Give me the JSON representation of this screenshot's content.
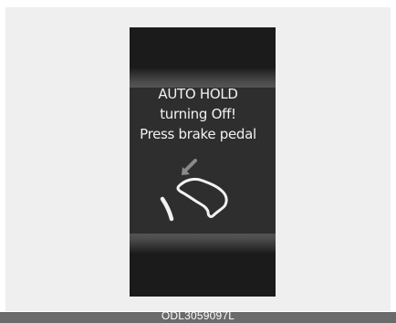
{
  "display": {
    "line1": "AUTO HOLD",
    "line2": "turning Off!",
    "line3": "Press brake pedal",
    "icon": "brake-pedal-press-icon"
  },
  "caption": "ODL3059097L",
  "colors": {
    "background": "#efefef",
    "display_bg": "#1b1b1b",
    "text": "#f2f2f2",
    "arrow": "#8a8a8a",
    "caption_bar": "#6b6b6b"
  }
}
